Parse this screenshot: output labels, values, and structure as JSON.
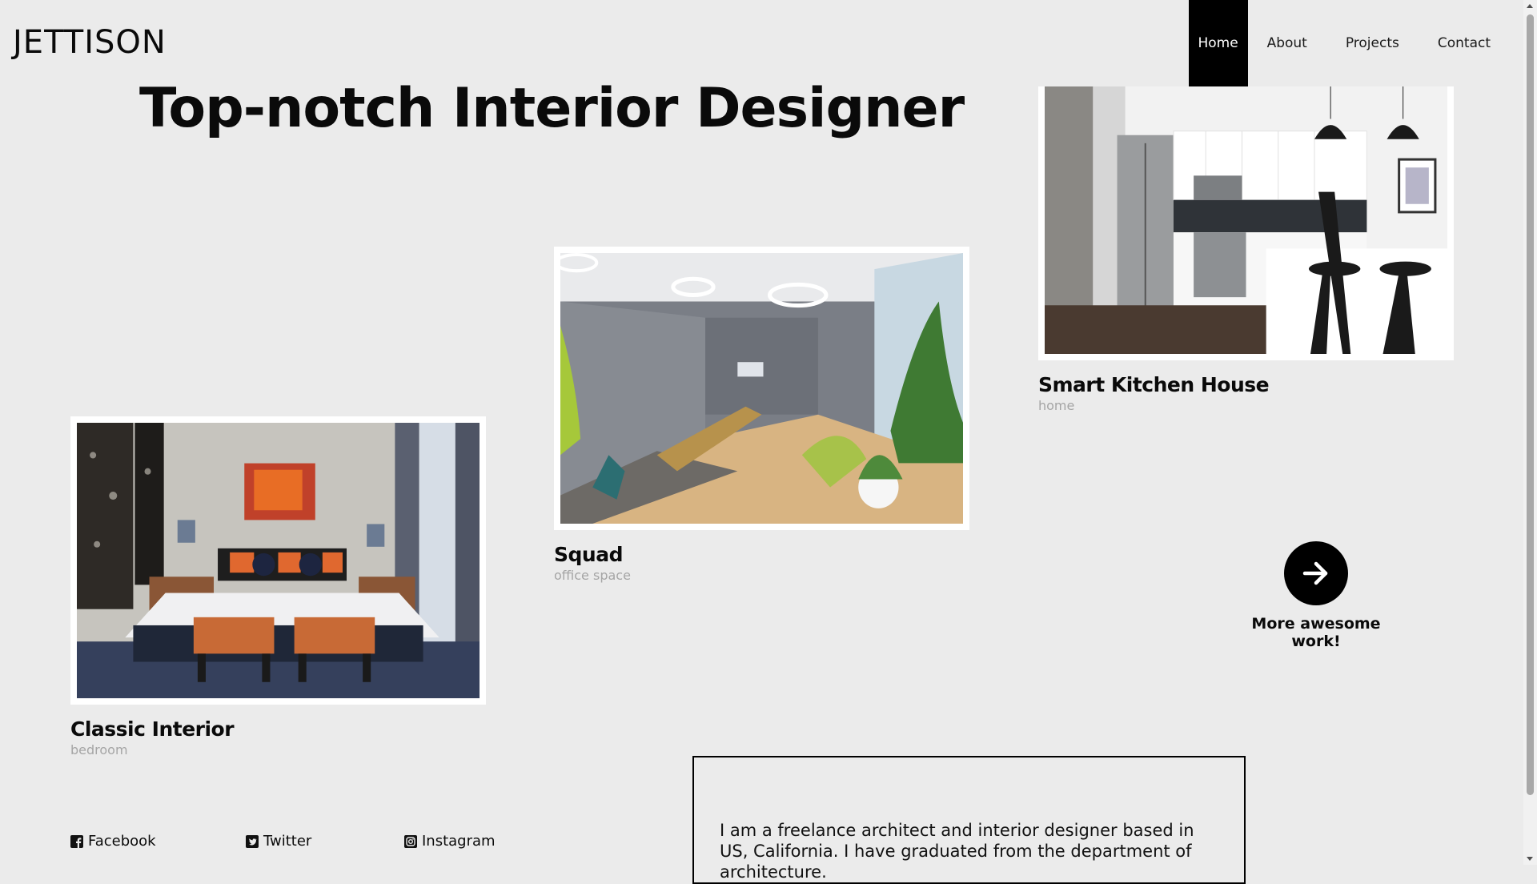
{
  "brand": {
    "logo": "JETTISON"
  },
  "nav": {
    "items": [
      {
        "label": "Home",
        "active": true
      },
      {
        "label": "About"
      },
      {
        "label": "Projects"
      },
      {
        "label": "Contact"
      }
    ]
  },
  "hero": {
    "title": "Top-notch Interior Designer"
  },
  "projects": [
    {
      "title": "Smart Kitchen House",
      "category": "home"
    },
    {
      "title": "Squad",
      "category": "office space"
    },
    {
      "title": "Classic Interior",
      "category": "bedroom"
    }
  ],
  "more": {
    "label": "More awesome work!",
    "icon": "arrow-right-icon"
  },
  "about": {
    "text": "I am a freelance architect and interior designer based in US, California. I have graduated from the department of architecture."
  },
  "social": [
    {
      "label": "Facebook",
      "icon": "facebook-icon"
    },
    {
      "label": "Twitter",
      "icon": "twitter-icon"
    },
    {
      "label": "Instagram",
      "icon": "instagram-icon"
    }
  ],
  "colors": {
    "background": "#ebebeb",
    "accent": "#000000",
    "muted": "#a5a5a5"
  }
}
